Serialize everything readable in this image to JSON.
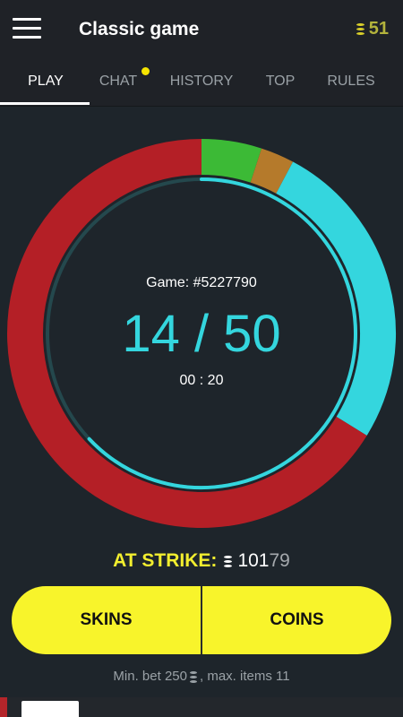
{
  "header": {
    "title": "Classic game",
    "balance": "51",
    "menu_icon": "hamburger-menu-icon",
    "coin_icon": "coin-stack-icon"
  },
  "tabs": [
    {
      "label": "PLAY",
      "active": true
    },
    {
      "label": "CHAT",
      "active": false,
      "notification": true
    },
    {
      "label": "HISTORY",
      "active": false
    },
    {
      "label": "TOP",
      "active": false
    },
    {
      "label": "RULES",
      "active": false
    }
  ],
  "game": {
    "label": "Game: #5227790",
    "count": "14 / 50",
    "timer": "00 : 20",
    "progress_fraction": 0.28,
    "segments": [
      {
        "color": "#3cba36",
        "fraction": 0.05
      },
      {
        "color": "#b57a2b",
        "fraction": 0.028
      },
      {
        "color": "#34d6de",
        "fraction": 0.26
      },
      {
        "color": "#b41f26",
        "fraction": 0.662
      }
    ]
  },
  "strike": {
    "label": "AT STRIKE:",
    "value_main": "101",
    "value_tail": "79"
  },
  "buttons": {
    "skins": "SKINS",
    "coins": "COINS"
  },
  "footnote": {
    "prefix": "Min. bet 250",
    "suffix": ", max. items 11"
  },
  "colors": {
    "background": "#1e252b",
    "accent_yellow": "#f8f42b",
    "accent_cyan": "#34d6de",
    "accent_red": "#b41f26"
  }
}
